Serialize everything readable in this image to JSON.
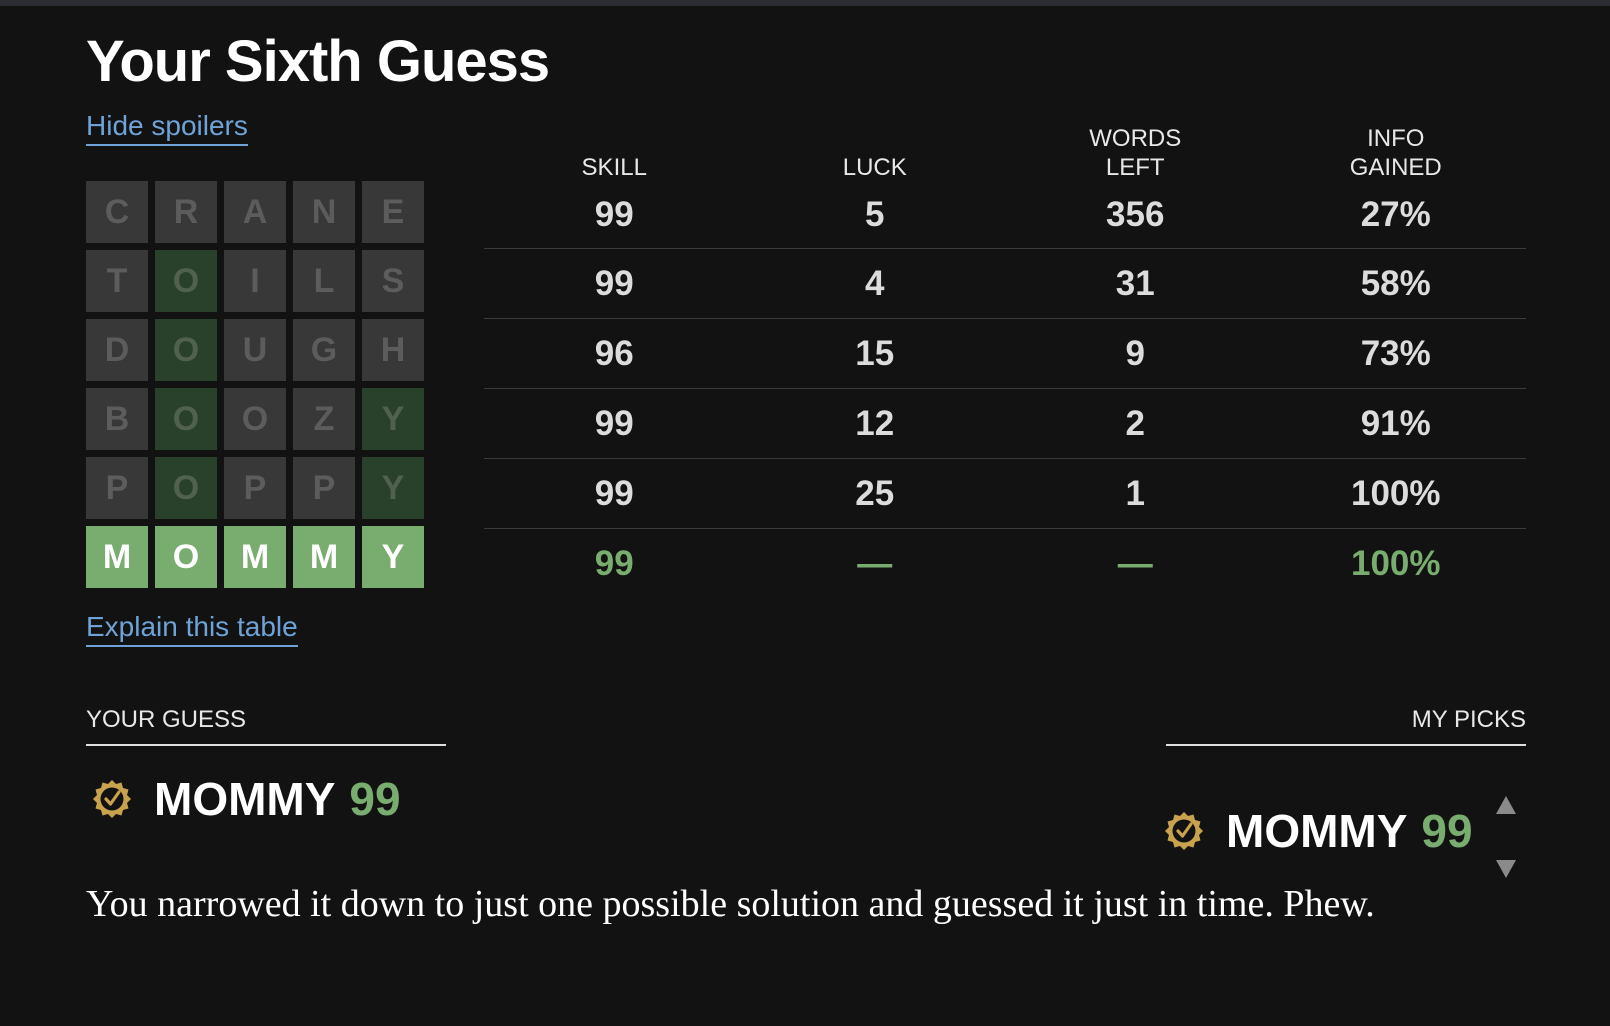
{
  "title": "Your Sixth Guess",
  "links": {
    "hide_spoilers": "Hide spoilers",
    "explain_table": "Explain this table"
  },
  "grid": [
    {
      "letters": [
        "C",
        "R",
        "A",
        "N",
        "E"
      ],
      "states": [
        "absent",
        "absent",
        "absent",
        "absent",
        "absent"
      ]
    },
    {
      "letters": [
        "T",
        "O",
        "I",
        "L",
        "S"
      ],
      "states": [
        "absent",
        "present",
        "absent",
        "absent",
        "absent"
      ]
    },
    {
      "letters": [
        "D",
        "O",
        "U",
        "G",
        "H"
      ],
      "states": [
        "absent",
        "present",
        "absent",
        "absent",
        "absent"
      ]
    },
    {
      "letters": [
        "B",
        "O",
        "O",
        "Z",
        "Y"
      ],
      "states": [
        "absent",
        "present",
        "absent",
        "absent",
        "present"
      ]
    },
    {
      "letters": [
        "P",
        "O",
        "P",
        "P",
        "Y"
      ],
      "states": [
        "absent",
        "present",
        "absent",
        "absent",
        "present"
      ]
    },
    {
      "letters": [
        "M",
        "O",
        "M",
        "M",
        "Y"
      ],
      "states": [
        "correct",
        "correct",
        "correct",
        "correct",
        "correct"
      ]
    }
  ],
  "table": {
    "headers": [
      "SKILL",
      "LUCK",
      "WORDS\nLEFT",
      "INFO\nGAINED"
    ],
    "rows": [
      [
        "99",
        "5",
        "356",
        "27%"
      ],
      [
        "99",
        "4",
        "31",
        "58%"
      ],
      [
        "96",
        "15",
        "9",
        "73%"
      ],
      [
        "99",
        "12",
        "2",
        "91%"
      ],
      [
        "99",
        "25",
        "1",
        "100%"
      ],
      [
        "99",
        "—",
        "—",
        "100%"
      ]
    ]
  },
  "your_guess": {
    "label": "YOUR GUESS",
    "word": "MOMMY",
    "score": "99"
  },
  "my_picks": {
    "label": "MY PICKS",
    "word": "MOMMY",
    "score": "99"
  },
  "description": "You narrowed it down to just one possible solution and guessed it just in time. Phew.",
  "colors": {
    "background": "#121212",
    "tile_absent": "#383838",
    "tile_present_dim": "#29402a",
    "tile_correct": "#79ac6f",
    "accent_green": "#79ac6f",
    "link_blue": "#6fa3d8",
    "badge_gold": "#c9a24e"
  },
  "icons": {
    "verified_badge": "verified-badge-icon",
    "arrow_up": "arrow-up-icon",
    "arrow_down": "arrow-down-icon"
  }
}
